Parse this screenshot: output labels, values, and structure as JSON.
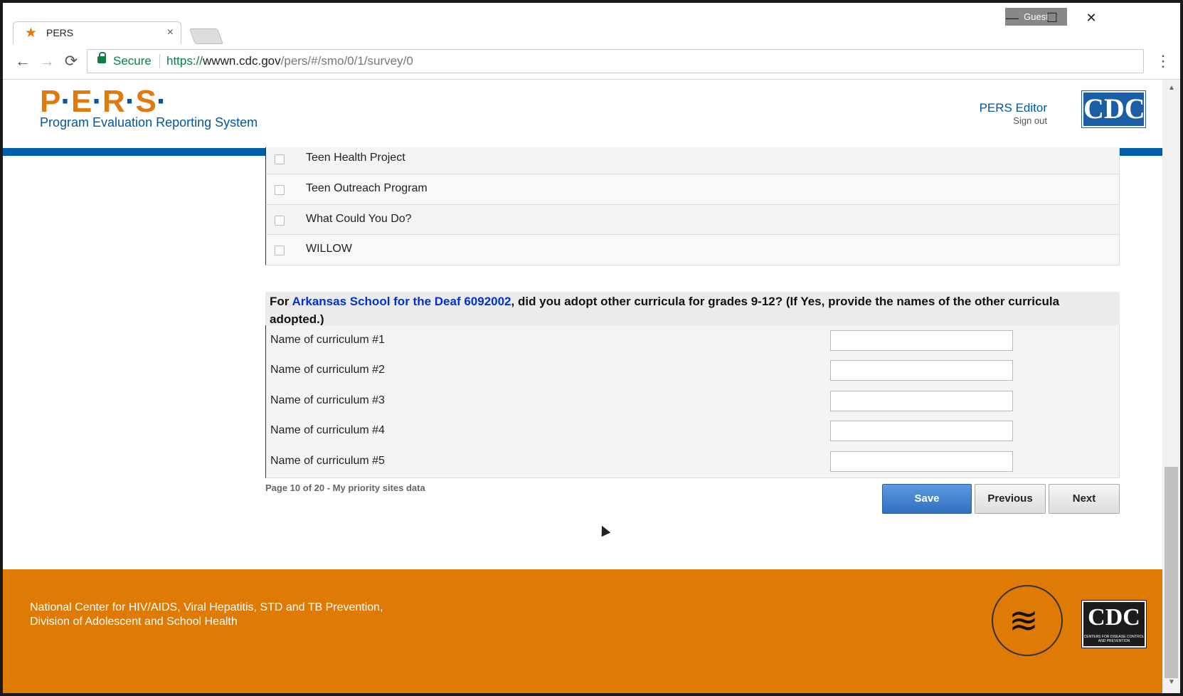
{
  "browser": {
    "tab_title": "PERS",
    "tab_close": "×",
    "guest_label": "Guest",
    "minimize": "—",
    "maximize": "☐",
    "close": "✕",
    "secure_label": "Secure",
    "url_scheme": "https://",
    "url_host": "wwwn.cdc.gov",
    "url_path": "/pers/#/smo/0/1/survey/0",
    "back": "←",
    "forward": "→",
    "reload": "⟳",
    "menu": "⋮"
  },
  "header": {
    "logo": "P·E·R·S·",
    "logo_parts": [
      "P",
      "·",
      "E",
      "·",
      "R",
      "·",
      "S",
      "·"
    ],
    "subtitle": "Program Evaluation Reporting System",
    "editor_link": "PERS Editor",
    "signout_link": "Sign out",
    "cdc_logo": "CDC"
  },
  "curricula_list": [
    {
      "label": "Teen Health Project"
    },
    {
      "label": "Teen Outreach Program"
    },
    {
      "label": "What Could You Do?"
    },
    {
      "label": "WILLOW"
    }
  ],
  "question": {
    "prefix": "For ",
    "site": "Arkansas School for the Deaf 6092002",
    "suffix": ", did you adopt other curricula for grades 9-12? (If Yes, provide the names of the other curricula adopted.)"
  },
  "curriculum_inputs": [
    {
      "label": "Name of curriculum #1",
      "value": ""
    },
    {
      "label": "Name of curriculum #2",
      "value": ""
    },
    {
      "label": "Name of curriculum #3",
      "value": ""
    },
    {
      "label": "Name of curriculum #4",
      "value": ""
    },
    {
      "label": "Name of curriculum #5",
      "value": ""
    }
  ],
  "pagination": {
    "info": "Page 10 of 20 - My priority sites data",
    "save": "Save",
    "previous": "Previous",
    "next": "Next"
  },
  "footer": {
    "line1": "National Center for HIV/AIDS, Viral Hepatitis, STD and TB Prevention,",
    "line2": "Division of Adolescent and School Health",
    "cdc_logo": "CDC",
    "cdc_tagline": "CENTERS FOR DISEASE CONTROL AND PREVENTION"
  }
}
